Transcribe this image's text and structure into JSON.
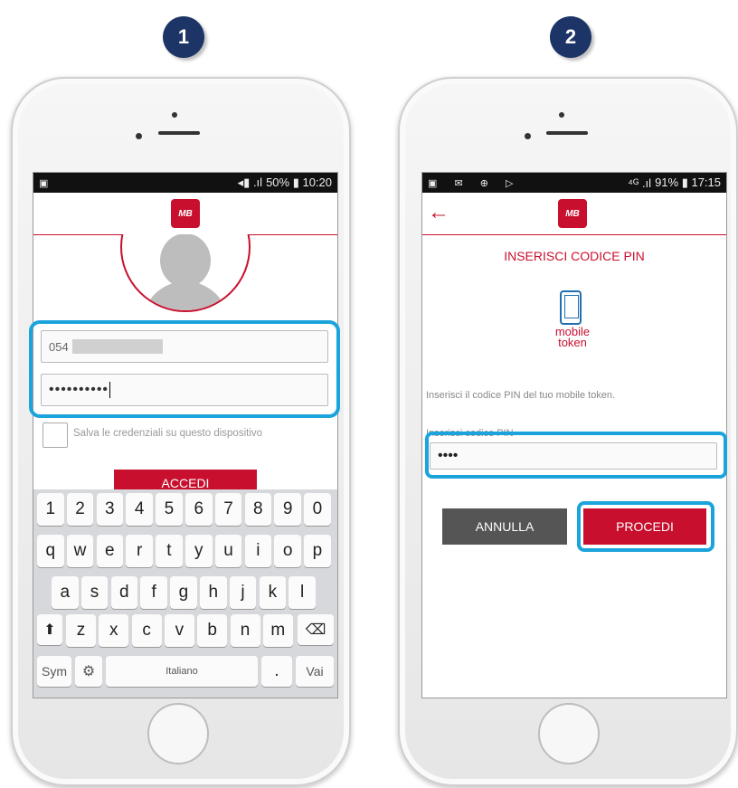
{
  "steps": [
    "1",
    "2"
  ],
  "phone1": {
    "status_right": "50% ▮ 10:20",
    "username_value": "054",
    "password_value": "••••••••••",
    "remember_label": "Salva le credenziali su questo dispositivo",
    "login_button": "ACCEDI",
    "keyboard": {
      "row1": [
        "1",
        "2",
        "3",
        "4",
        "5",
        "6",
        "7",
        "8",
        "9",
        "0"
      ],
      "row2": [
        "q",
        "w",
        "e",
        "r",
        "t",
        "y",
        "u",
        "i",
        "o",
        "p"
      ],
      "row3": [
        "a",
        "s",
        "d",
        "f",
        "g",
        "h",
        "j",
        "k",
        "l"
      ],
      "row4": [
        "z",
        "x",
        "c",
        "v",
        "b",
        "n",
        "m"
      ],
      "shift": "⬆",
      "backspace": "⌫",
      "sym": "Sym",
      "settings": "⚙",
      "space": "Italiano",
      "period": ".",
      "enter": "Vai"
    }
  },
  "phone2": {
    "status_right": "91% ▮ 17:15",
    "back_arrow": "←",
    "title": "INSERISCI CODICE PIN",
    "token_label_line1": "mobile",
    "token_label_line2": "token",
    "instruction": "Inserisci il codice PIN del tuo mobile token.",
    "pin_label": "Inserisci codice PIN",
    "pin_value": "••••",
    "cancel_button": "ANNULLA",
    "proceed_button": "PROCEDI"
  },
  "colors": {
    "brand_red": "#c8102e",
    "highlight_blue": "#1ba4dc",
    "badge_navy": "#1d3466"
  },
  "logo_text": "MB"
}
